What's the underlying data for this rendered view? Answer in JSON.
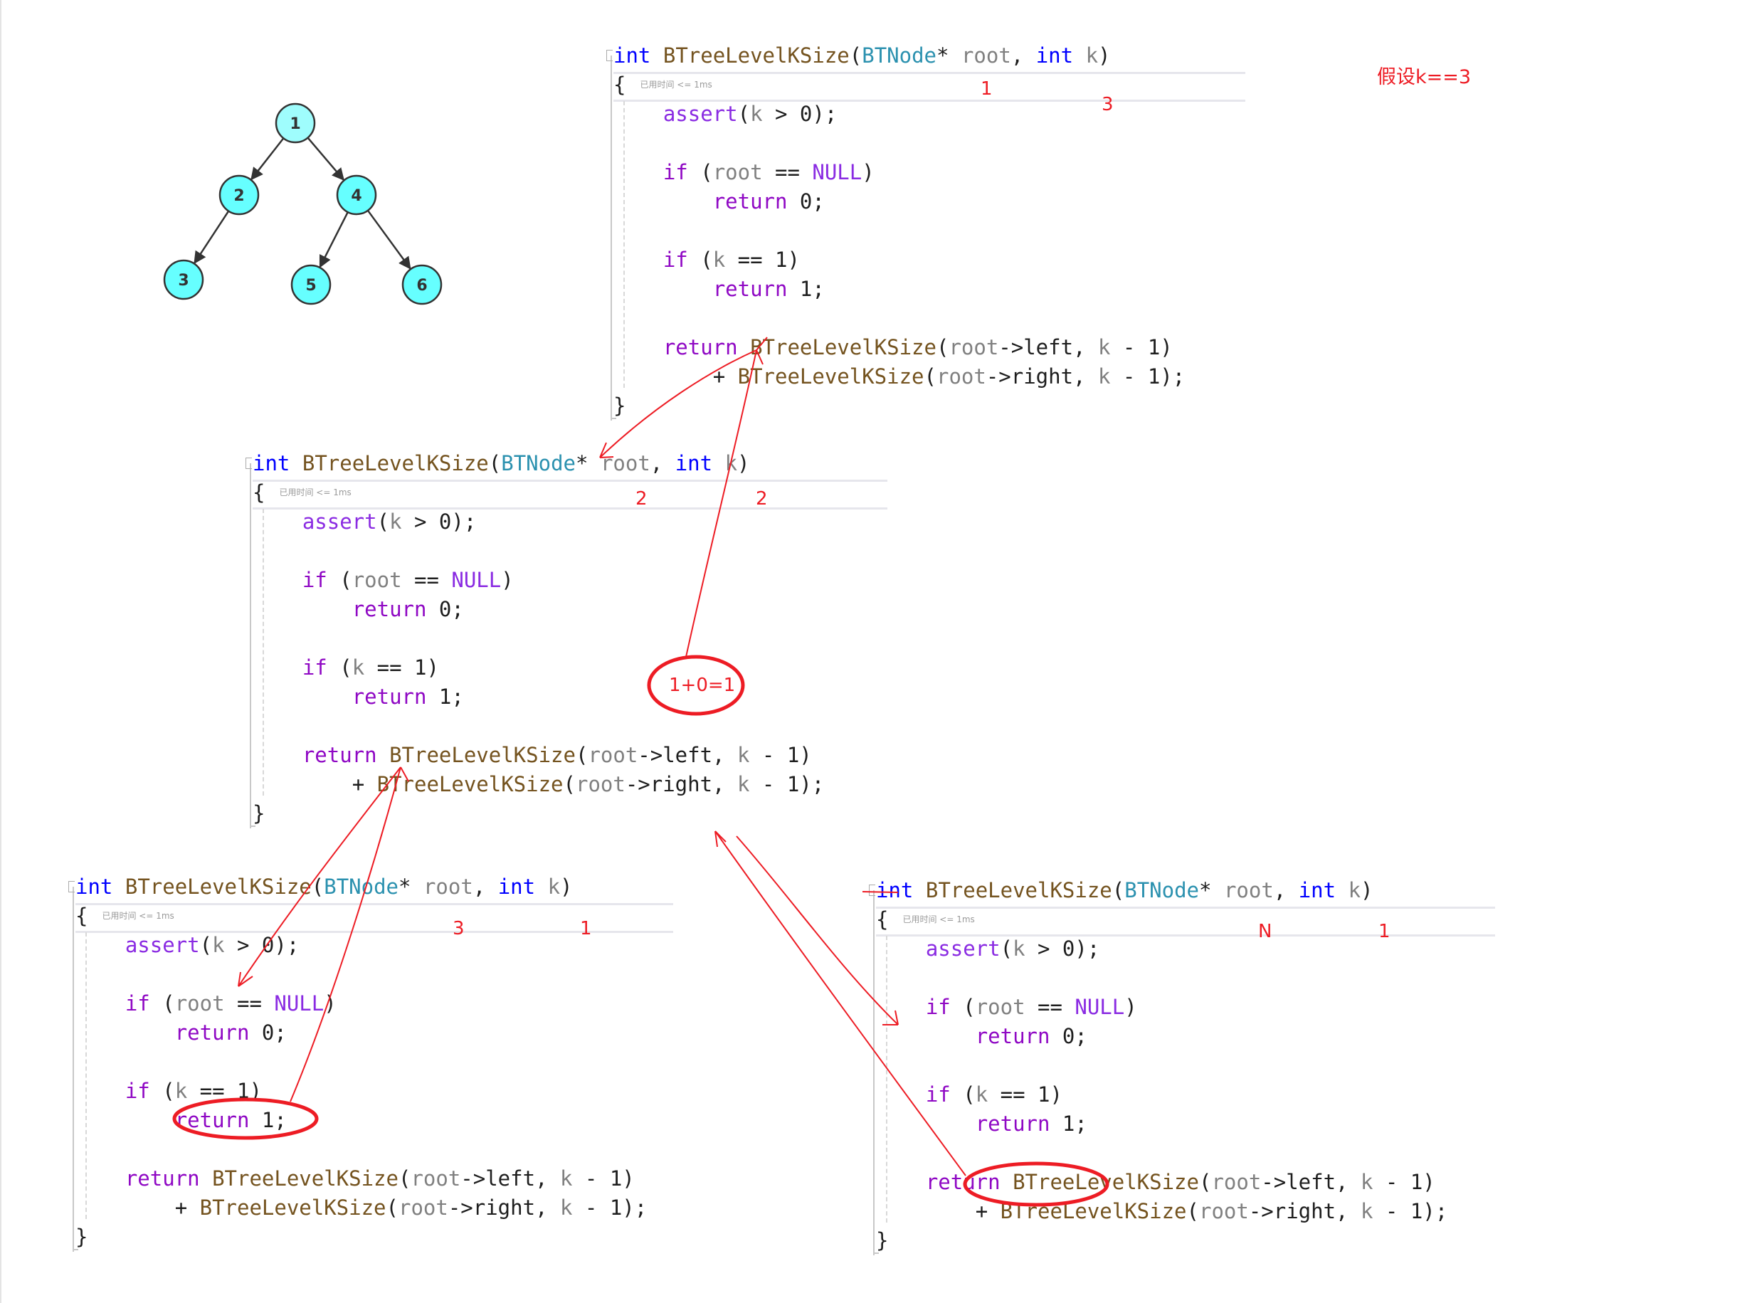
{
  "tree": {
    "nodes": [
      {
        "id": "1",
        "label": "1",
        "fill": "#9ffdfd"
      },
      {
        "id": "2",
        "label": "2",
        "fill": "#66ffff"
      },
      {
        "id": "4",
        "label": "4",
        "fill": "#66ffff"
      },
      {
        "id": "3",
        "label": "3",
        "fill": "#66ffff"
      },
      {
        "id": "5",
        "label": "5",
        "fill": "#66ffff"
      },
      {
        "id": "6",
        "label": "6",
        "fill": "#66ffff"
      }
    ],
    "edges": [
      [
        "1",
        "2"
      ],
      [
        "1",
        "4"
      ],
      [
        "2",
        "3"
      ],
      [
        "4",
        "5"
      ],
      [
        "4",
        "6"
      ]
    ]
  },
  "assumption": "假设k==3",
  "code": {
    "header": {
      "kw_int": "int",
      "fn_name": "BTreeLevelKSize",
      "open": "(",
      "type": "BTNode",
      "star": "*",
      "param_root": "root",
      "comma": ",",
      "kw_int2": "int",
      "param_k": "k",
      "close": ")"
    },
    "open_brace": "{",
    "hint": "已用时间 <= 1ms",
    "assert_kw": "assert",
    "assert_rest_open": "(",
    "assert_k": "k",
    "assert_rest": " > 0);",
    "if_kw": "if",
    "if1_open": " (",
    "if1_root": "root",
    "if1_eq": " == ",
    "if1_null": "NULL",
    "if1_close": ")",
    "return_kw": "return",
    "ret0": " 0;",
    "if2_open": " (",
    "if2_k": "k",
    "if2_rest": " == 1)",
    "ret1": " 1;",
    "rec_fn": "BTreeLevelKSize",
    "rec_open": "(",
    "rec_root": "root",
    "rec_left": "->left, ",
    "rec_right": "->right, ",
    "rec_k": "k",
    "rec_tail1": " - 1)",
    "rec_tail2": " - 1);",
    "plus": "+ ",
    "close_brace": "}"
  },
  "blocks": [
    {
      "id": "top",
      "annotations": [
        "1",
        "3"
      ]
    },
    {
      "id": "middle",
      "annotations": [
        "2",
        "2"
      ]
    },
    {
      "id": "bottom-left",
      "annotations": [
        "3",
        "1"
      ]
    },
    {
      "id": "bottom-right",
      "annotations": [
        "N",
        "1"
      ]
    }
  ],
  "result_bubble": "1+0=1",
  "colors": {
    "annotation_red": "#ed1c24",
    "keyword_blue": "#0000ff",
    "function_brown": "#74531f",
    "type_teal": "#2b91af",
    "control_purple": "#8f08c4"
  }
}
